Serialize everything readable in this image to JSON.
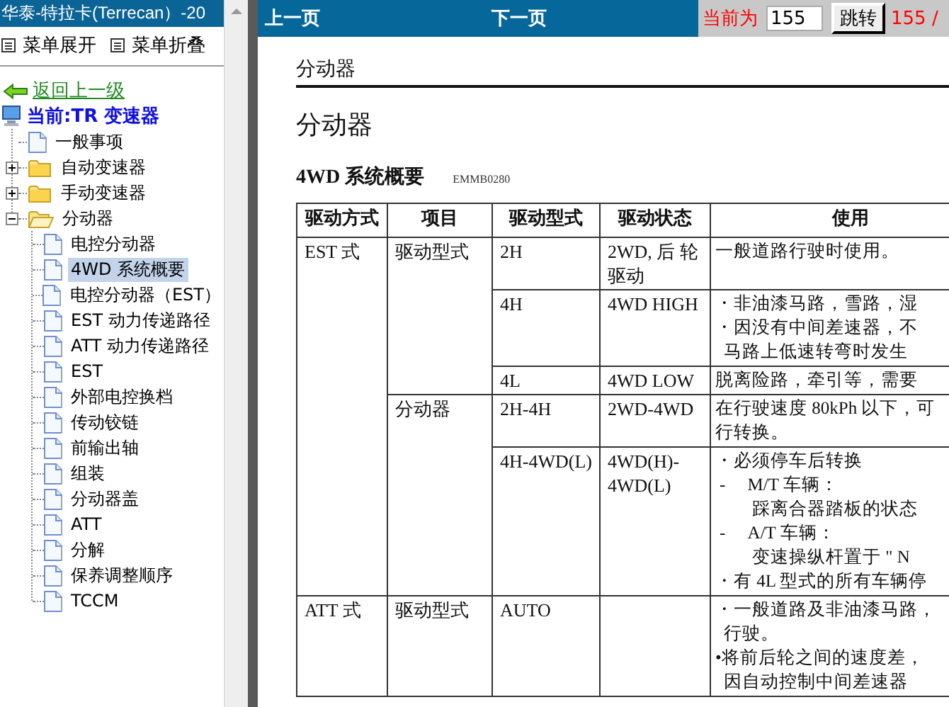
{
  "sidebar": {
    "title": "华泰-特拉卡(Terrecan）-20",
    "menu": [
      {
        "label": "菜单展开"
      },
      {
        "label": "菜单折叠"
      }
    ],
    "back_link": "返回上一级",
    "current": "当前:TR 变速器",
    "tree": [
      {
        "kind": "page",
        "label": "一般事项",
        "selected": false
      },
      {
        "kind": "folder",
        "label": "自动变速器",
        "expanded": false,
        "selected": false
      },
      {
        "kind": "folder",
        "label": "手动变速器",
        "expanded": false,
        "selected": false
      },
      {
        "kind": "folder",
        "label": "分动器",
        "expanded": true,
        "selected": false,
        "children": [
          {
            "kind": "page",
            "label": "电控分动器",
            "selected": false
          },
          {
            "kind": "page",
            "label": "4WD 系统概要",
            "selected": true
          },
          {
            "kind": "page",
            "label": "电控分动器（EST）",
            "selected": false
          },
          {
            "kind": "page",
            "label": "EST 动力传递路径",
            "selected": false
          },
          {
            "kind": "page",
            "label": "ATT 动力传递路径",
            "selected": false
          },
          {
            "kind": "page",
            "label": "EST",
            "selected": false
          },
          {
            "kind": "page",
            "label": "外部电控换档",
            "selected": false
          },
          {
            "kind": "page",
            "label": "传动铰链",
            "selected": false
          },
          {
            "kind": "page",
            "label": "前输出轴",
            "selected": false
          },
          {
            "kind": "page",
            "label": "组装",
            "selected": false
          },
          {
            "kind": "page",
            "label": "分动器盖",
            "selected": false
          },
          {
            "kind": "page",
            "label": "ATT",
            "selected": false
          },
          {
            "kind": "page",
            "label": "分解",
            "selected": false
          },
          {
            "kind": "page",
            "label": "保养调整顺序",
            "selected": false
          },
          {
            "kind": "page",
            "label": "TCCM",
            "selected": false
          }
        ]
      }
    ]
  },
  "toolbar": {
    "prev": "上一页",
    "next": "下一页",
    "page_label": "当前为",
    "page_input": "155",
    "jump_button": "跳转",
    "page_count": "155 /"
  },
  "document": {
    "section": "分动器",
    "title": "分动器",
    "subtitle": "4WD 系统概要",
    "code": "EMMB0280",
    "table": {
      "columns": [
        "驱动方式",
        "项目",
        "驱动型式",
        "驱动状态",
        "使用"
      ],
      "groups": [
        {
          "method": "EST 式",
          "items": [
            {
              "item": "驱动型式",
              "modes": [
                {
                  "type": "2H",
                  "state": "2WD, 后 轮驱动",
                  "usage": [
                    {
                      "kind": "plain",
                      "text": "一般道路行驶时使用。"
                    }
                  ]
                },
                {
                  "type": "4H",
                  "state": "4WD HIGH",
                  "usage": [
                    {
                      "kind": "bullet",
                      "mark": "・",
                      "text": "非油漆马路，雪路，湿"
                    },
                    {
                      "kind": "bullet",
                      "mark": "・",
                      "text": "因没有中间差速器，不"
                    },
                    {
                      "kind": "continuation",
                      "text": "马路上低速转弯时发生"
                    }
                  ]
                },
                {
                  "type": "4L",
                  "state": "4WD LOW",
                  "usage": [
                    {
                      "kind": "plain",
                      "text": "脱离险路，牵引等，需要"
                    }
                  ]
                }
              ]
            },
            {
              "item": "分动器",
              "modes": [
                {
                  "type": "2H-4H",
                  "state": "2WD-4WD",
                  "usage": [
                    {
                      "kind": "plain",
                      "text": "在行驶速度 80kPh 以下，可"
                    },
                    {
                      "kind": "plain",
                      "text": "行转换。"
                    }
                  ]
                },
                {
                  "type": "4H-4WD(L)",
                  "state": "4WD(H)-4WD(L)",
                  "usage": [
                    {
                      "kind": "bullet",
                      "mark": "・",
                      "text": "必须停车后转换"
                    },
                    {
                      "kind": "dash",
                      "mark": "-",
                      "text": "M/T 车辆："
                    },
                    {
                      "kind": "sub",
                      "text": "踩离合器踏板的状态"
                    },
                    {
                      "kind": "dash",
                      "mark": "-",
                      "text": "A/T 车辆："
                    },
                    {
                      "kind": "sub",
                      "text": "变速操纵杆置于 \" N"
                    },
                    {
                      "kind": "bullet",
                      "mark": "・",
                      "text": "有 4L 型式的所有车辆停"
                    }
                  ]
                }
              ]
            }
          ]
        },
        {
          "method": "ATT 式",
          "items": [
            {
              "item": "驱动型式",
              "modes": [
                {
                  "type": "AUTO",
                  "usage": [
                    {
                      "kind": "bullet",
                      "mark": "・",
                      "text": "一般道路及非油漆马路，"
                    },
                    {
                      "kind": "continuation",
                      "text": "行驶。"
                    },
                    {
                      "kind": "bullet",
                      "mark": "•",
                      "text": "将前后轮之间的速度差，"
                    },
                    {
                      "kind": "continuation",
                      "text": "因自动控制中间差速器"
                    }
                  ]
                }
              ]
            }
          ]
        }
      ]
    }
  }
}
